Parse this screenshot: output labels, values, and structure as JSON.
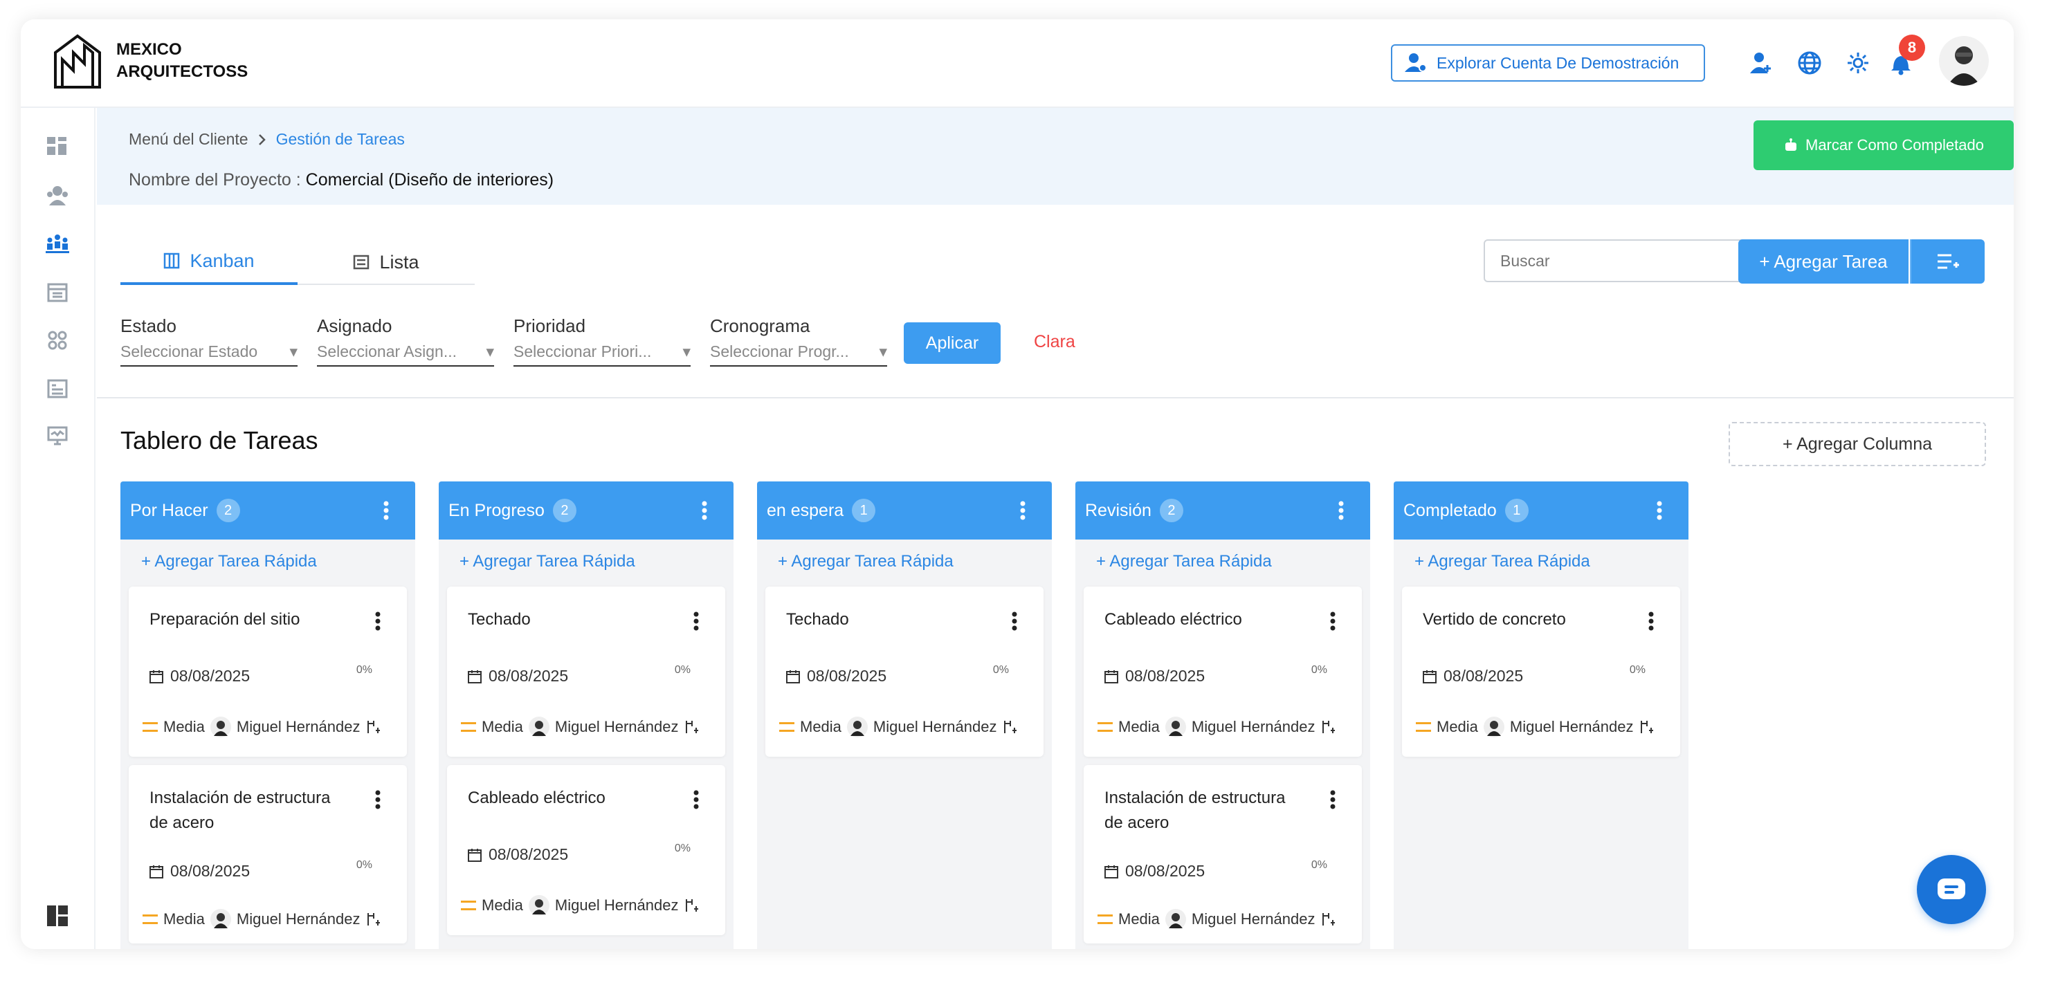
{
  "colors": {
    "accent": "#3d9cf0",
    "success": "#2ecc71",
    "danger": "#ef4444",
    "badge": "#f04438",
    "priority_medium": "#f5a623"
  },
  "brand": {
    "line1": "MEXICO",
    "line2": "ARQUITECTOSS",
    "logo_icon": "building-logo-icon"
  },
  "header": {
    "demo_label": "Explorar Cuenta De Demostración",
    "notifications_count": "8",
    "icons": [
      "user-plus-icon",
      "globe-icon",
      "gear-icon",
      "bell-icon"
    ]
  },
  "sidebar": {
    "icons": [
      "dashboard-icon",
      "users-group-icon",
      "team-icon",
      "calendar-icon",
      "modules-icon",
      "report-icon",
      "monitor-icon",
      "layout-icon"
    ]
  },
  "breadcrumb": {
    "root": "Menú del Cliente",
    "current": "Gestión de Tareas"
  },
  "project": {
    "label": "Nombre del Proyecto :",
    "name": "Comercial (Diseño de interiores)"
  },
  "complete_button": "Marcar Como Completado",
  "tabs": [
    {
      "label": "Kanban",
      "active": true
    },
    {
      "label": "Lista",
      "active": false
    }
  ],
  "search": {
    "placeholder": "Buscar"
  },
  "add_task": "+ Agregar Tarea",
  "filters": [
    {
      "label": "Estado",
      "value": "Seleccionar Estado"
    },
    {
      "label": "Asignado",
      "value": "Seleccionar Asign..."
    },
    {
      "label": "Prioridad",
      "value": "Seleccionar Priori..."
    },
    {
      "label": "Cronograma",
      "value": "Seleccionar Progr..."
    }
  ],
  "apply": "Aplicar",
  "clear": "Clara",
  "board": {
    "title": "Tablero de Tareas",
    "add_column": "+ Agregar Columna",
    "quick_add": "+ Agregar Tarea Rápida"
  },
  "columns": [
    {
      "name": "Por Hacer",
      "count": "2",
      "cards": [
        {
          "title": "Preparación del sitio",
          "date": "08/08/2025",
          "progress": "0%",
          "priority": "Media",
          "assignee": "Miguel Hernández"
        },
        {
          "title": "Instalación de estructura de acero",
          "date": "08/08/2025",
          "progress": "0%",
          "priority": "Media",
          "assignee": "Miguel Hernández"
        }
      ]
    },
    {
      "name": "En Progreso",
      "count": "2",
      "cards": [
        {
          "title": "Techado",
          "date": "08/08/2025",
          "progress": "0%",
          "priority": "Media",
          "assignee": "Miguel Hernández"
        },
        {
          "title": "Cableado eléctrico",
          "date": "08/08/2025",
          "progress": "0%",
          "priority": "Media",
          "assignee": "Miguel Hernández"
        }
      ]
    },
    {
      "name": "en espera",
      "count": "1",
      "cards": [
        {
          "title": "Techado",
          "date": "08/08/2025",
          "progress": "0%",
          "priority": "Media",
          "assignee": "Miguel Hernández"
        }
      ]
    },
    {
      "name": "Revisión",
      "count": "2",
      "cards": [
        {
          "title": "Cableado eléctrico",
          "date": "08/08/2025",
          "progress": "0%",
          "priority": "Media",
          "assignee": "Miguel Hernández"
        },
        {
          "title": "Instalación de estructura de acero",
          "date": "08/08/2025",
          "progress": "0%",
          "priority": "Media",
          "assignee": "Miguel Hernández"
        }
      ]
    },
    {
      "name": "Completado",
      "count": "1",
      "cards": [
        {
          "title": "Vertido de concreto",
          "date": "08/08/2025",
          "progress": "0%",
          "priority": "Media",
          "assignee": "Miguel Hernández"
        }
      ]
    }
  ]
}
